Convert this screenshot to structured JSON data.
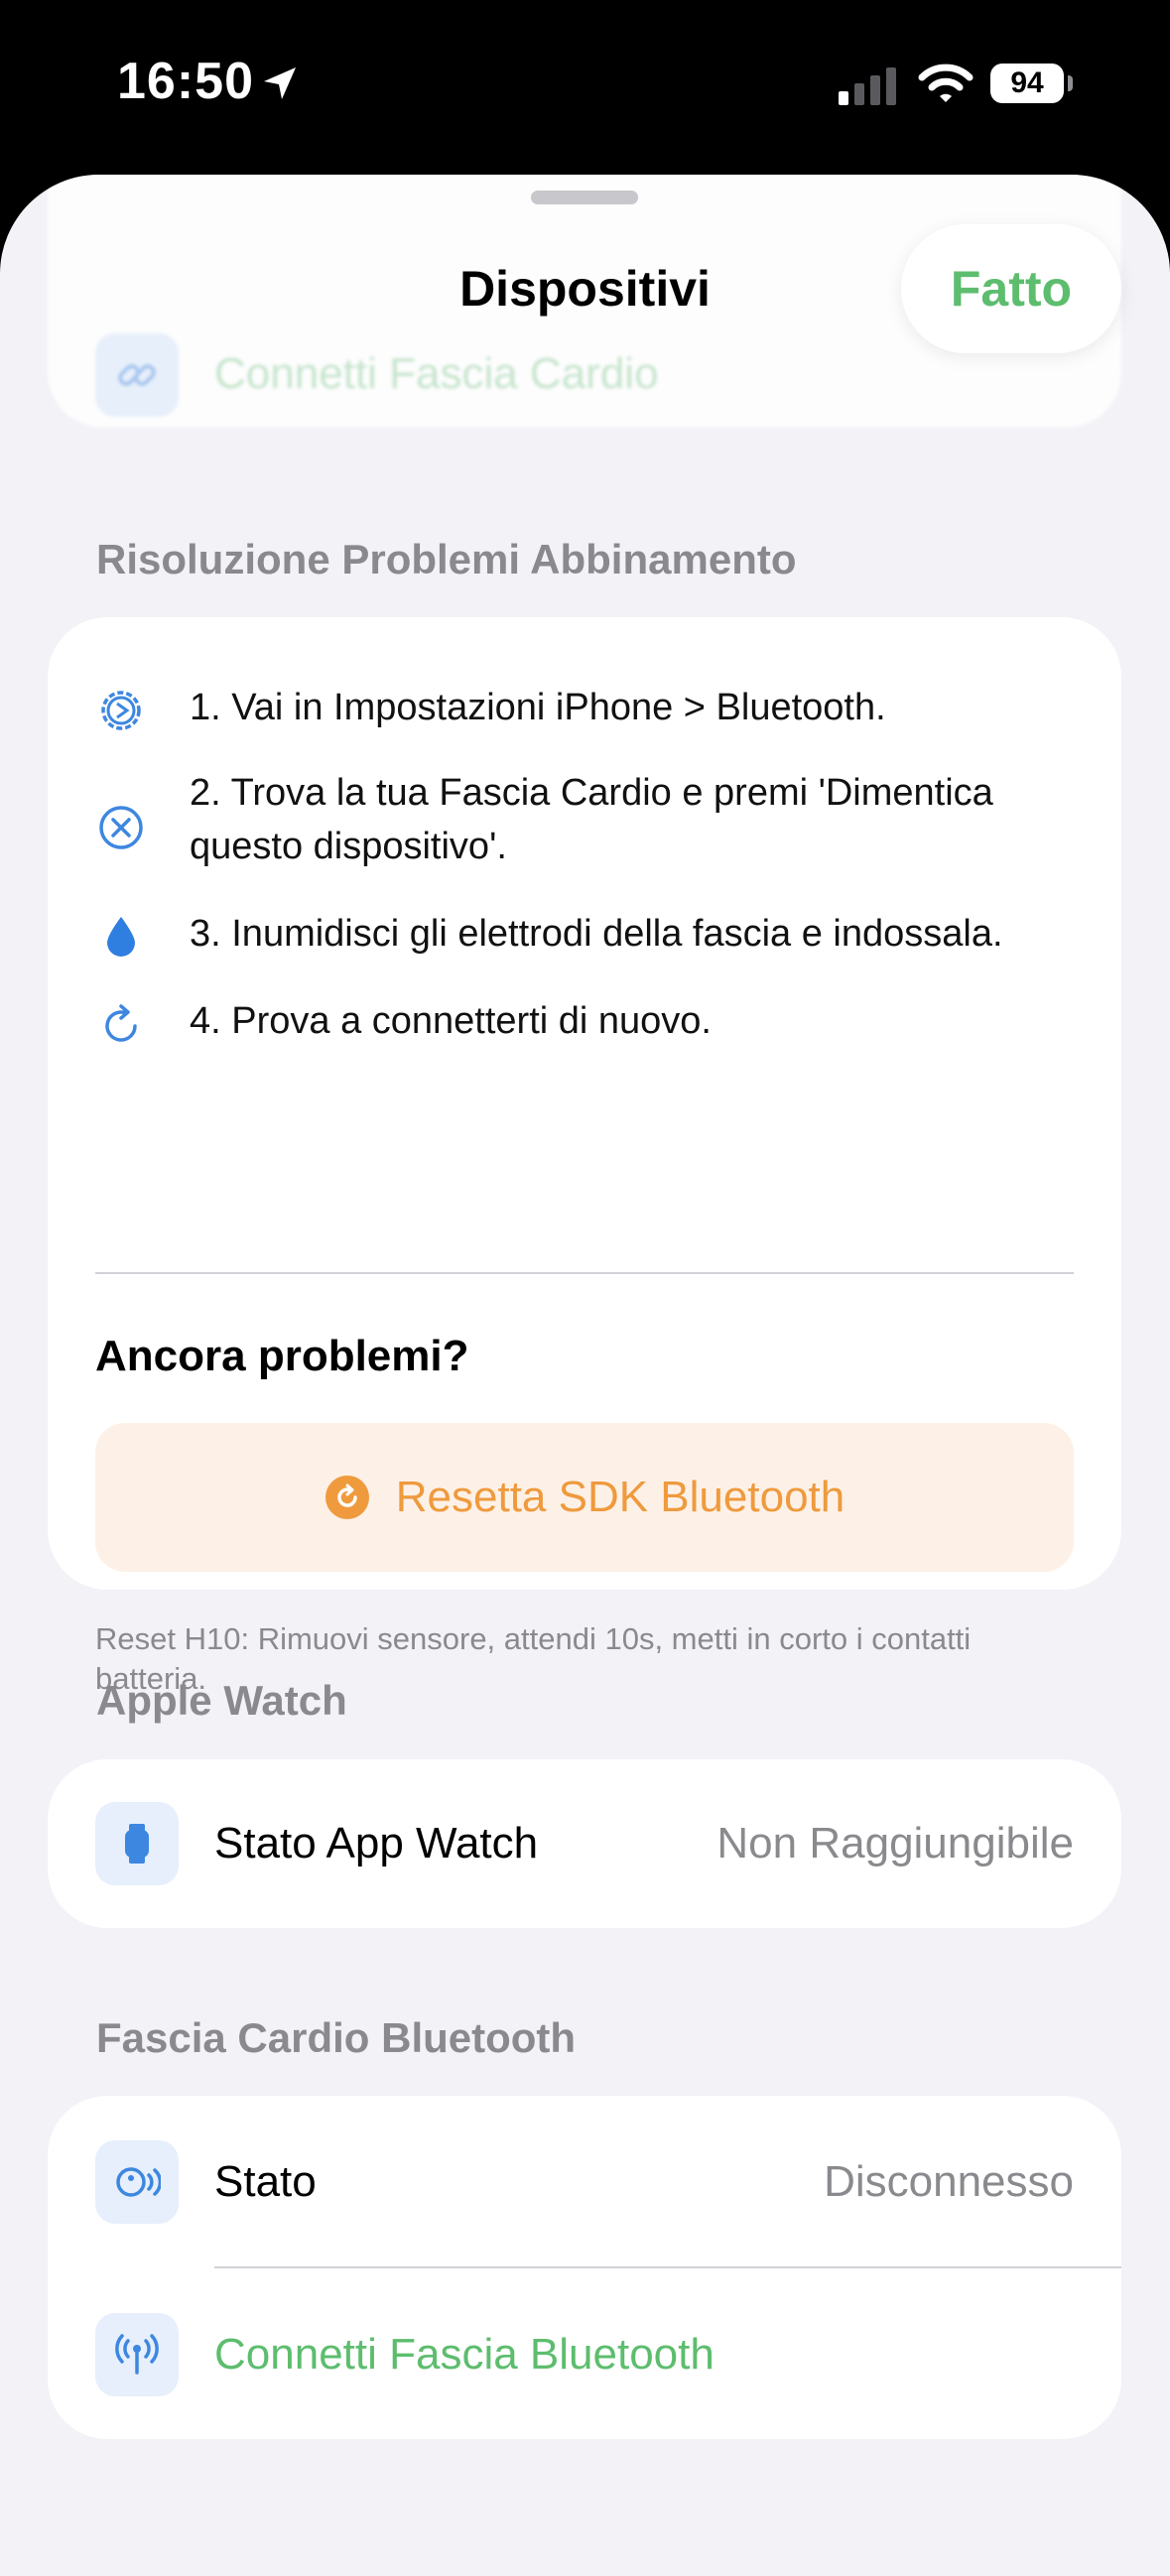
{
  "status_bar": {
    "time": "16:50",
    "battery": "94",
    "icons": [
      "location-arrow-icon",
      "cellular-signal-icon",
      "wifi-icon",
      "battery-icon"
    ]
  },
  "nav": {
    "title": "Dispositivi",
    "done_label": "Fatto"
  },
  "ghost_row": {
    "label": "Connetti Fascia Cardio",
    "icon": "link-icon"
  },
  "troubleshoot": {
    "header": "Risoluzione Problemi Abbinamento",
    "steps": [
      {
        "icon": "gear-icon",
        "text": "1. Vai in Impostazioni iPhone > Bluetooth."
      },
      {
        "icon": "x-circle-icon",
        "text": "2. Trova la tua Fascia Cardio e premi 'Dimentica questo dispositivo'."
      },
      {
        "icon": "drop-icon",
        "text": "3. Inumidisci gli elettrodi della fascia e indossala."
      },
      {
        "icon": "refresh-icon",
        "text": "4. Prova a connetterti di nuovo."
      }
    ],
    "still_problems": "Ancora problemi?",
    "reset_label": "Resetta SDK Bluetooth",
    "note": "Reset H10: Rimuovi sensore, attendi 10s, metti in corto i contatti batteria."
  },
  "apple_watch": {
    "header": "Apple Watch",
    "row_label": "Stato App Watch",
    "row_value": "Non Raggiungibile",
    "icon": "watch-icon"
  },
  "bluetooth_strap": {
    "header": "Fascia Cardio Bluetooth",
    "status_label": "Stato",
    "status_value": "Disconnesso",
    "status_icon": "sensor-icon",
    "connect_label": "Connetti Fascia Bluetooth",
    "connect_icon": "antenna-icon"
  },
  "colors": {
    "accent_green": "#5dbd6e",
    "accent_blue": "#3d87e0",
    "accent_orange": "#ef9a3d",
    "secondary_text": "#8a8a8e",
    "background": "#f2f2f7"
  }
}
